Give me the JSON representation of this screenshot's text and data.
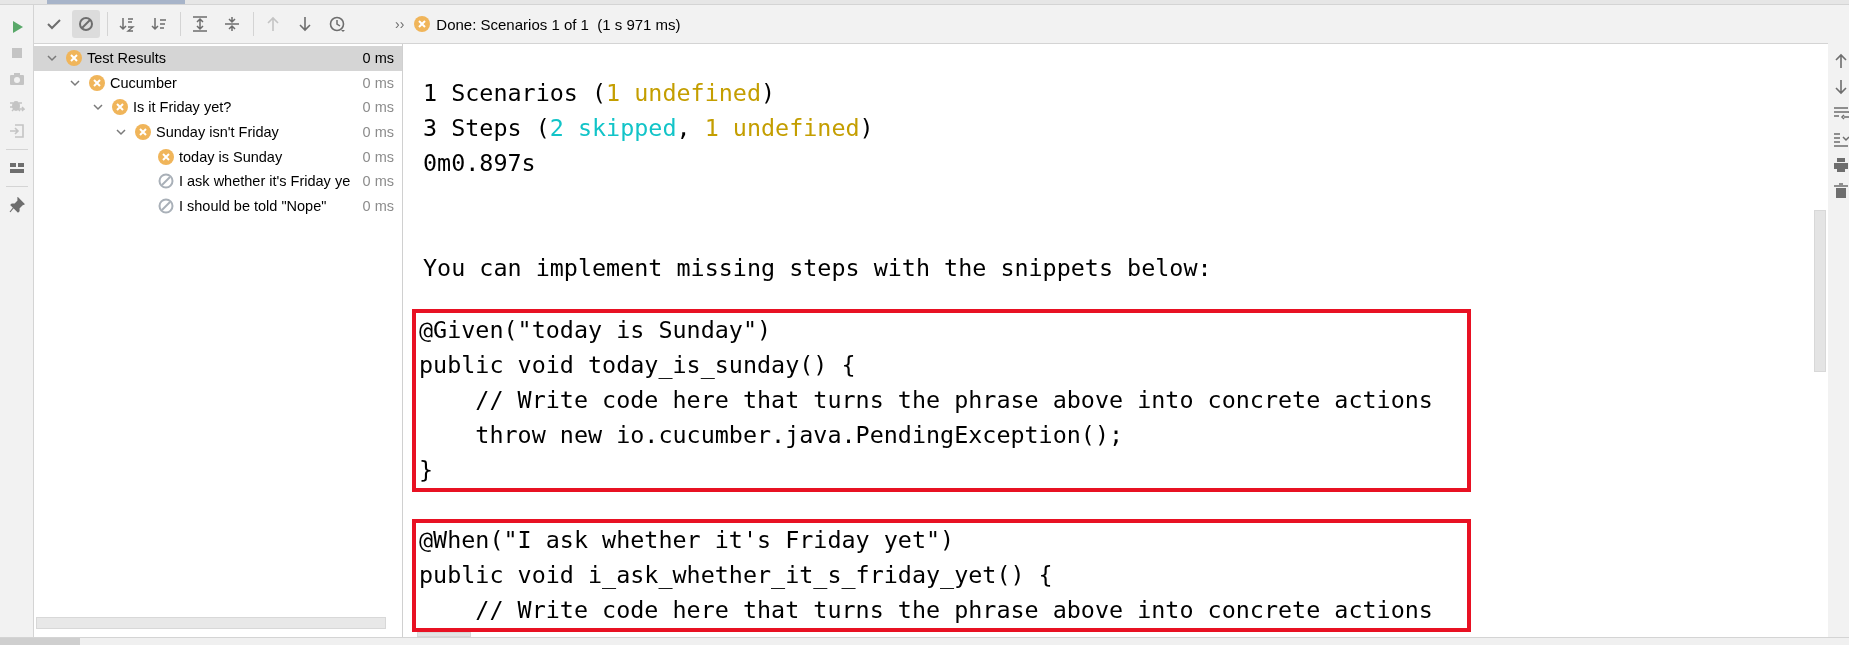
{
  "left_toolbar": [
    {
      "kind": "run",
      "disabled": false
    },
    {
      "kind": "stop",
      "disabled": true
    },
    {
      "kind": "camera",
      "disabled": true
    },
    {
      "kind": "debug",
      "disabled": true
    },
    {
      "kind": "import",
      "disabled": true
    },
    {
      "kind": "layout",
      "disabled": false
    },
    {
      "kind": "pin",
      "disabled": false
    }
  ],
  "toolbar": {
    "buttons": [
      {
        "kind": "check",
        "disabled": false
      },
      {
        "kind": "ignored",
        "selected": true,
        "disabled": false
      },
      {
        "kind": "sort-alpha",
        "disabled": false
      },
      {
        "kind": "sort-duration",
        "disabled": false
      },
      {
        "kind": "expand-all",
        "disabled": false
      },
      {
        "kind": "collapse-all",
        "disabled": false
      },
      {
        "kind": "previous",
        "disabled": true
      },
      {
        "kind": "next",
        "disabled": false
      },
      {
        "kind": "history",
        "disabled": false
      }
    ],
    "overflow": "››",
    "status": {
      "kind": "failed",
      "text": "Done: Scenarios 1 of 1  (1 s 971 ms)"
    }
  },
  "tree": {
    "label": "Test Results",
    "time": "0 ms",
    "kind": "failed",
    "expanded": true,
    "selected": true,
    "children": [
      {
        "label": "Cucumber",
        "time": "0 ms",
        "kind": "failed",
        "expanded": true,
        "selected": false,
        "children": [
          {
            "label": "Is it Friday yet?",
            "time": "0 ms",
            "kind": "failed",
            "expanded": true,
            "selected": false,
            "children": [
              {
                "label": "Sunday isn't Friday",
                "time": "0 ms",
                "kind": "failed",
                "expanded": true,
                "selected": false,
                "children": [
                  {
                    "label": "today is Sunday",
                    "time": "0 ms",
                    "kind": "failed",
                    "selected": false
                  },
                  {
                    "label": "I ask whether it's Friday ye",
                    "time": "0 ms",
                    "kind": "ignored",
                    "selected": false
                  },
                  {
                    "label": "I should be told \"Nope\"",
                    "time": "0 ms",
                    "kind": "ignored",
                    "selected": false
                  }
                ]
              }
            ]
          }
        ]
      }
    ]
  },
  "console": {
    "summary": [
      [
        {
          "text": "1 Scenarios (",
          "kind": "plain"
        },
        {
          "text": "1 undefined",
          "kind": "undefined"
        },
        {
          "text": ")",
          "kind": "plain"
        }
      ],
      [
        {
          "text": "3 Steps (",
          "kind": "plain"
        },
        {
          "text": "2 skipped",
          "kind": "skipped"
        },
        {
          "text": ", ",
          "kind": "plain"
        },
        {
          "text": "1 undefined",
          "kind": "undefined"
        },
        {
          "text": ")",
          "kind": "plain"
        }
      ],
      [
        {
          "text": "0m0.897s",
          "kind": "plain"
        }
      ]
    ],
    "intro": "You can implement missing steps with the snippets below:",
    "snippets": [
      {
        "lines": [
          "@Given(\"today is Sunday\")",
          "public void today_is_sunday() {",
          "    // Write code here that turns the phrase above into concrete actions",
          "    throw new io.cucumber.java.PendingException();",
          "}"
        ]
      },
      {
        "lines": [
          "@When(\"I ask whether it's Friday yet\")",
          "public void i_ask_whether_it_s_friday_yet() {",
          "    // Write code here that turns the phrase above into concrete actions"
        ]
      }
    ]
  },
  "right_toolbar": [
    {
      "kind": "up"
    },
    {
      "kind": "down"
    },
    {
      "kind": "soft-wrap"
    },
    {
      "kind": "scroll-end"
    },
    {
      "kind": "print"
    },
    {
      "kind": "trash"
    }
  ]
}
